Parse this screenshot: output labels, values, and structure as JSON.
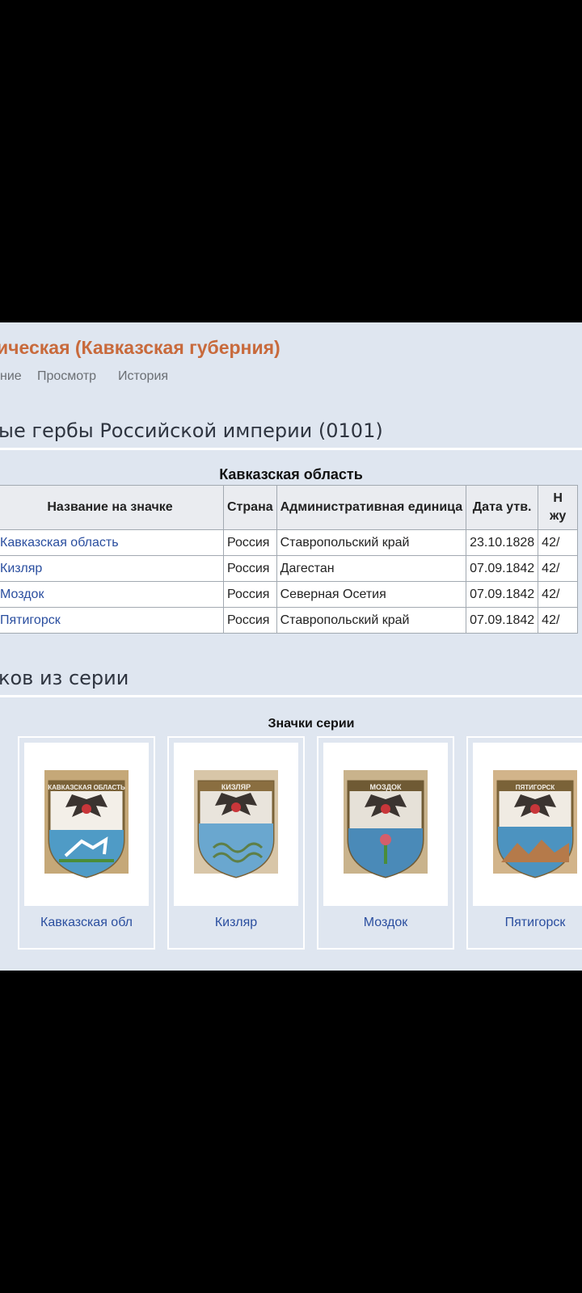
{
  "header": {
    "title": "ическая (Кавказская губерния)",
    "actions": [
      "ние",
      "Просмотр",
      "История"
    ]
  },
  "section1": {
    "heading": "ые гербы Российской империи (0101)"
  },
  "table": {
    "caption": "Кавказская область",
    "columns": [
      "Название на значке",
      "Страна",
      "Административная единица",
      "Дата утв.",
      "Н\nжу"
    ],
    "rows": [
      {
        "name": "Кавказская область",
        "country": "Россия",
        "unit": "Ставропольский край",
        "date": "23.10.1828",
        "extra": "42/"
      },
      {
        "name": "Кизляр",
        "country": "Россия",
        "unit": "Дагестан",
        "date": "07.09.1842",
        "extra": "42/"
      },
      {
        "name": "Моздок",
        "country": "Россия",
        "unit": "Северная Осетия",
        "date": "07.09.1842",
        "extra": "42/"
      },
      {
        "name": "Пятигорск",
        "country": "Россия",
        "unit": "Ставропольский край",
        "date": "07.09.1842",
        "extra": "42/"
      }
    ]
  },
  "section2": {
    "heading": "ков из серии"
  },
  "gallery": {
    "title": "Значки серии",
    "items": [
      {
        "caption": "Кавказская обл",
        "badge_text": "КАВКАЗСКАЯ ОБЛАСТЬ",
        "bottom_color": "#4f9bc6"
      },
      {
        "caption": "Кизляр",
        "badge_text": "КИЗЛЯР",
        "bottom_color": "#6aa7cf"
      },
      {
        "caption": "Моздок",
        "badge_text": "МОЗДОК",
        "bottom_color": "#4a8ab8"
      },
      {
        "caption": "Пятигорск",
        "badge_text": "ПЯТИГОРСК",
        "bottom_color": "#4c93c0"
      }
    ]
  }
}
